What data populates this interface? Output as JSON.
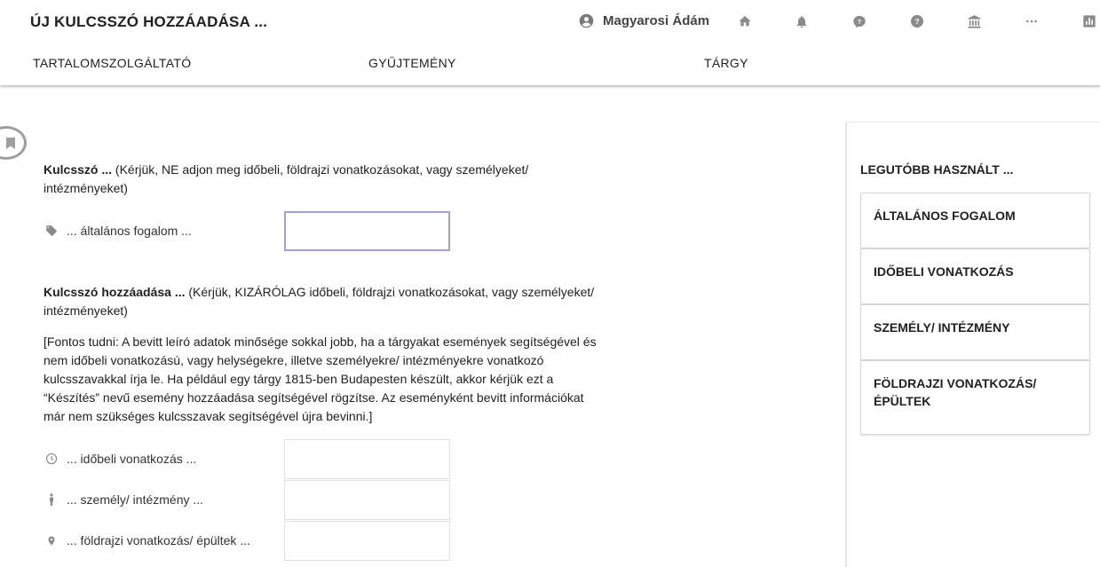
{
  "header": {
    "title": "ÚJ KULCSSZÓ HOZZÁADÁSA ...",
    "user_name": "Magyarosi Ádám",
    "icons": [
      "account-circle-icon",
      "home-icon",
      "bell-icon",
      "help-bubble-icon",
      "help-circle-icon",
      "museum-icon",
      "more-icon",
      "chart-icon"
    ]
  },
  "nav": {
    "items": [
      "TARTALOMSZOLGÁLTATÓ",
      "GYŰJTEMÉNY",
      "TÁRGY"
    ]
  },
  "keyword_section": {
    "title_bold": "Kulcsszó ...",
    "title_rest": " (Kérjük, NE adjon meg időbeli, földrajzi vonatkozásokat, vagy személyeket/ intézményeket)",
    "general_label": "... általános fogalom ...",
    "general_icon": "tag-icon"
  },
  "add_section": {
    "title_bold": "Kulcsszó hozzáadása ...",
    "title_rest": " (Kérjük, KIZÁRÓLAG időbeli, földrajzi vonatkozásokat, vagy személyeket/ intézményeket)",
    "notice": "[Fontos tudni: A bevitt leíró adatok minősége sokkal jobb, ha a tárgyakat események segítségével és nem időbeli vonatkozású, vagy helységekre, illetve személyekre/ intézményekre vonatkozó kulcsszavakkal írja le. Ha például egy tárgy 1815-ben Budapesten készült, akkor kérjük ezt a “Készítés” nevű esemény hozzáadása segítségével rögzítse. Az eseményként bevitt információkat már nem szükséges kulcsszavak segítségével újra bevinni.]",
    "rows": [
      {
        "label": "... időbeli vonatkozás ...",
        "icon": "clock-icon"
      },
      {
        "label": "... személy/ intézmény ...",
        "icon": "person-icon"
      },
      {
        "label": "... földrajzi vonatkozás/ épültek ...",
        "icon": "map-pin-icon"
      }
    ]
  },
  "sidebar": {
    "title": "LEGUTÓBB HASZNÁLT ...",
    "cards": [
      "ÁLTALÁNOS FOGALOM",
      "IDŐBELI VONATKOZÁS",
      "SZEMÉLY/ INTÉZMÉNY",
      "FÖLDRAJZI VONATKOZÁS/ ÉPÜLTEK"
    ]
  },
  "colors": {
    "icon_gray": "#8a8a8a",
    "focus_border": "#9fa3d3"
  }
}
